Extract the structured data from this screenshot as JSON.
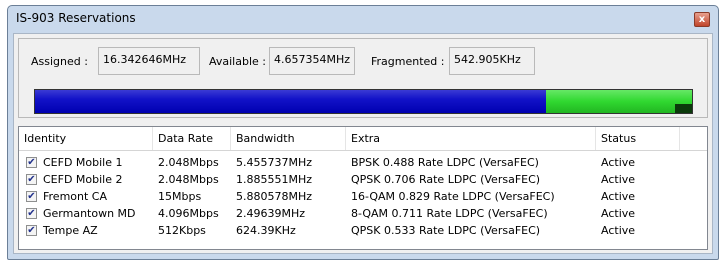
{
  "window": {
    "title": "IS-903 Reservations",
    "close_glyph": "x"
  },
  "stats": {
    "assigned_label": "Assigned :",
    "assigned_value": "16.342646MHz",
    "available_label": "Available :",
    "available_value": "4.657354MHz",
    "fragmented_label": "Fragmented :",
    "fragmented_value": "542.905KHz"
  },
  "usage_bar": {
    "assigned_fraction": 0.7782,
    "available_fraction": 0.2218,
    "fragmented_fraction": 0.0259,
    "colors": {
      "assigned": "#0000b0",
      "available": "#30d830",
      "fragmented": "#0b3a0b"
    }
  },
  "table": {
    "columns": [
      "Identity",
      "Data Rate",
      "Bandwidth",
      "Extra",
      "Status"
    ],
    "rows": [
      {
        "checked": true,
        "identity": "CEFD Mobile 1",
        "data_rate": "2.048Mbps",
        "bandwidth": "5.455737MHz",
        "extra": "BPSK 0.488 Rate  LDPC (VersaFEC)",
        "status": "Active"
      },
      {
        "checked": true,
        "identity": "CEFD Mobile 2",
        "data_rate": "2.048Mbps",
        "bandwidth": "1.885551MHz",
        "extra": "QPSK 0.706 Rate  LDPC (VersaFEC)",
        "status": "Active"
      },
      {
        "checked": true,
        "identity": "Fremont CA",
        "data_rate": "15Mbps",
        "bandwidth": "5.880578MHz",
        "extra": "16-QAM 0.829 Rate  LDPC (VersaFEC)",
        "status": "Active"
      },
      {
        "checked": true,
        "identity": "Germantown MD",
        "data_rate": "4.096Mbps",
        "bandwidth": "2.49639MHz",
        "extra": "8-QAM 0.711 Rate  LDPC (VersaFEC)",
        "status": "Active"
      },
      {
        "checked": true,
        "identity": "Tempe AZ",
        "data_rate": "512Kbps",
        "bandwidth": "624.39KHz",
        "extra": "QPSK 0.533 Rate  LDPC (VersaFEC)",
        "status": "Active"
      }
    ]
  }
}
